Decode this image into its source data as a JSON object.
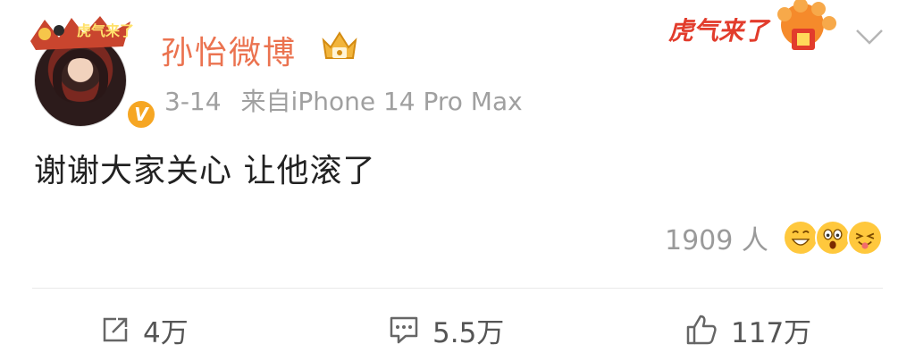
{
  "post": {
    "username": "孙怡微博",
    "timestamp": "3-14",
    "source": "来自iPhone 14 Pro Max",
    "content": "谢谢大家关心 让他滚了",
    "frame_text": "虎气来了",
    "deco_text": "虎气来了",
    "verified_mark": "V"
  },
  "reactions": {
    "count_label": "1909 人",
    "emojis": [
      "laughing-emoji",
      "shocked-emoji",
      "tongue-out-emoji"
    ]
  },
  "actions": {
    "repost": "4万",
    "comment": "5.5万",
    "like": "117万"
  },
  "colors": {
    "username": "#eb7350",
    "meta": "#a0a0a0",
    "content": "#222222",
    "badge": "#f6a623",
    "deco_red": "#e23c2c"
  },
  "icons": [
    "share-icon",
    "comment-icon",
    "like-icon",
    "chevron-down-icon",
    "vip-crown-icon"
  ]
}
